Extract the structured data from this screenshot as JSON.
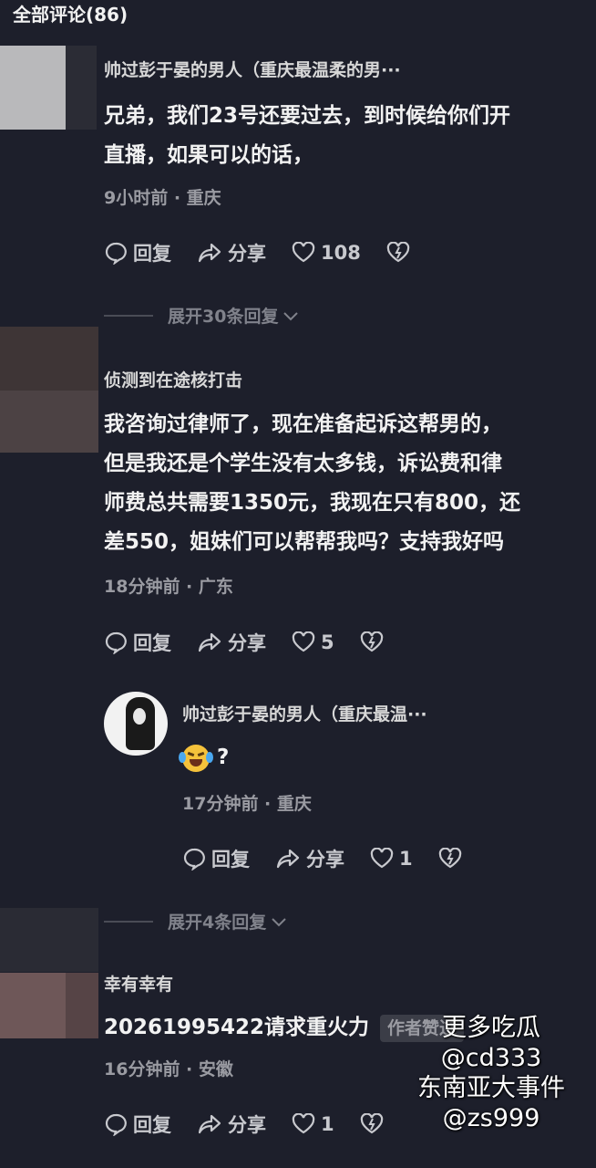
{
  "header": {
    "title": "全部评论(86)"
  },
  "comments": [
    {
      "username": "帅过彭于晏的男人（重庆最温柔的男···",
      "text_lines": [
        "兄弟，我们23号还要过去，到时候给你们开",
        "直播，如果可以的话，"
      ],
      "meta": "9小时前 · 重庆",
      "reply_label": "回复",
      "share_label": "分享",
      "likes": "108",
      "expand": "展开30条回复"
    },
    {
      "username": "侦测到在途核打击",
      "text_lines": [
        "我咨询过律师了，现在准备起诉这帮男的，",
        "但是我还是个学生没有太多钱，诉讼费和律",
        "师费总共需要1350元，我现在只有800，还",
        "差550，姐妹们可以帮帮我吗？支持我好吗"
      ],
      "meta": "18分钟前 · 广东",
      "reply_label": "回复",
      "share_label": "分享",
      "likes": "5",
      "reply": {
        "username": "帅过彭于晏的男人（重庆最温···",
        "text": "?",
        "meta": "17分钟前 · 重庆",
        "reply_label": "回复",
        "share_label": "分享",
        "likes": "1"
      },
      "expand": "展开4条回复"
    },
    {
      "username": "幸有幸有",
      "text": "20261995422请求重火力",
      "badge": "作者赞过",
      "meta": "16分钟前 · 安徽",
      "reply_label": "回复",
      "share_label": "分享",
      "likes": "1"
    }
  ],
  "watermark": [
    "更多吃瓜",
    "@cd333",
    "东南亚大事件",
    "@zs999"
  ],
  "colors": {
    "background": "#1d1f2b",
    "text": "#f2f2f2",
    "muted": "#9a9ba2"
  }
}
